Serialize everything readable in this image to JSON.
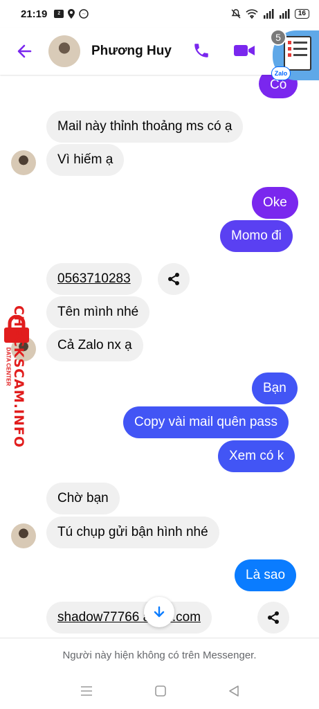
{
  "status_bar": {
    "time": "21:19",
    "battery": "16"
  },
  "header": {
    "contact_name": "Phương Huy"
  },
  "floating_bubble": {
    "badge_count": "5",
    "app_label": "Zalo"
  },
  "messages": [
    {
      "text": "Có",
      "side": "out"
    },
    {
      "text": "Mail này thỉnh thoảng ms có ạ",
      "side": "in"
    },
    {
      "text": "Vì hiếm ạ",
      "side": "in"
    },
    {
      "text": "Oke",
      "side": "out"
    },
    {
      "text": "Momo đi",
      "side": "out"
    },
    {
      "text": "0563710283",
      "side": "in"
    },
    {
      "text": "Tên mình nhé",
      "side": "in"
    },
    {
      "text": "Cả Zalo nx ạ",
      "side": "in"
    },
    {
      "text": "Bạn",
      "side": "out"
    },
    {
      "text": "Copy vài mail quên pass",
      "side": "out"
    },
    {
      "text": "Xem có k",
      "side": "out"
    },
    {
      "text": "Chờ bạn",
      "side": "in"
    },
    {
      "text": "Tú chụp gửi bận hình nhé",
      "side": "in"
    },
    {
      "text": "Là sao",
      "side": "out"
    },
    {
      "text": "shadow77766 ahoo.com",
      "side": "in"
    }
  ],
  "watermark": {
    "text": "CHECKSCAM.INFO",
    "subtext": "DATA CENTER"
  },
  "footer": {
    "notice": "Người này hiện không có trên Messenger."
  },
  "colors": {
    "accent": "#7a27ee",
    "incoming_bg": "#f0f0f0",
    "outgoing_blue": "#0a7cff"
  }
}
